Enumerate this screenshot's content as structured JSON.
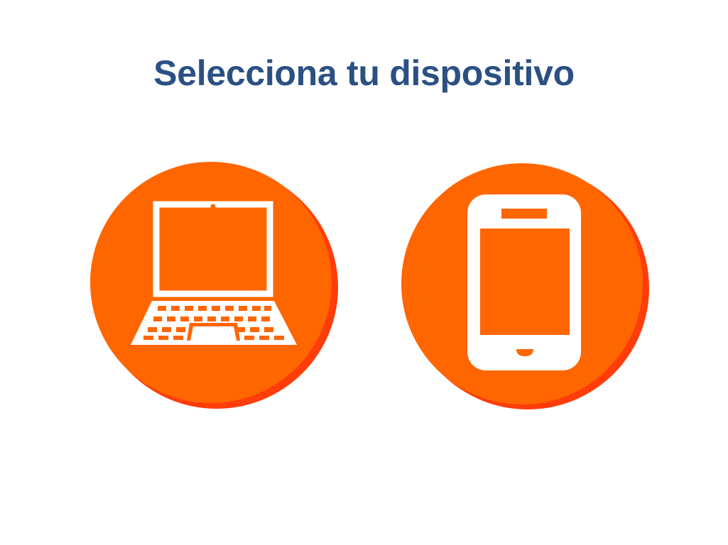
{
  "page": {
    "title": "Selecciona tu dispositivo"
  },
  "devices": [
    {
      "id": "laptop",
      "icon": "laptop-icon"
    },
    {
      "id": "phone",
      "icon": "smartphone-icon"
    }
  ],
  "colors": {
    "title": "#2b5083",
    "circle": "#ff6600",
    "circle_shadow": "#ff3d0a",
    "icon": "#ffffff"
  }
}
